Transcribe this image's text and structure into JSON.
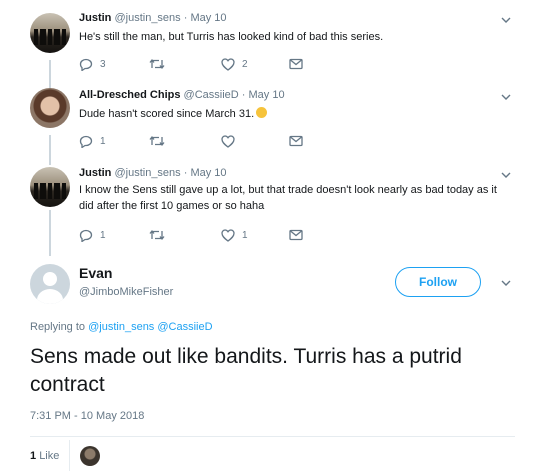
{
  "tweets": [
    {
      "name": "Justin",
      "handle": "@justin_sens",
      "date": "· May 10",
      "text": "He's still the man, but Turris has looked kind of bad this series.",
      "replies": "3",
      "retweets": "",
      "likes": "2"
    },
    {
      "name": "All-Dresched Chips",
      "handle": "@CassiieD",
      "date": "· May 10",
      "text": "Dude hasn't scored since March 31.",
      "replies": "1",
      "retweets": "",
      "likes": ""
    },
    {
      "name": "Justin",
      "handle": "@justin_sens",
      "date": "· May 10",
      "text": "I know the Sens still gave up a lot, but that trade doesn't look nearly as bad today as it did after the first 10 games or so haha",
      "replies": "1",
      "retweets": "",
      "likes": "1"
    }
  ],
  "main": {
    "name": "Evan",
    "handle": "@JimboMikeFisher",
    "follow_label": "Follow",
    "replying_prefix": "Replying to",
    "replying_to_1": "@justin_sens",
    "replying_to_2": "@CassiieD",
    "text": "Sens made out like bandits. Turris has a putrid contract",
    "timestamp": "7:31 PM - 10 May 2018",
    "like_count": "1",
    "like_label": "Like"
  },
  "colors": {
    "accent": "#1da1f2",
    "secondary_text": "#657786",
    "thread_line": "#ccd6dd"
  }
}
